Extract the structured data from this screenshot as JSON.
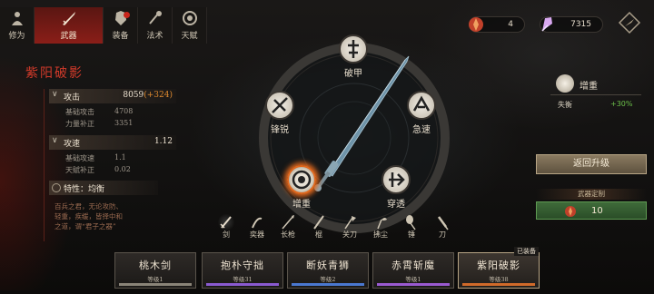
{
  "tabs": [
    {
      "label": "修为",
      "icon": "cultivation-icon"
    },
    {
      "label": "武器",
      "icon": "weapon-icon",
      "active": true
    },
    {
      "label": "装备",
      "icon": "equipment-icon",
      "badge": true
    },
    {
      "label": "法术",
      "icon": "spell-icon"
    },
    {
      "label": "天赋",
      "icon": "talent-icon"
    }
  ],
  "currency": [
    {
      "icon": "fire-gem-icon",
      "value": "4"
    },
    {
      "icon": "crystal-icon",
      "value": "7315"
    }
  ],
  "weapon": {
    "name": "紫阳破影",
    "attack": {
      "label": "攻击",
      "value": "8059",
      "bonus": "(+324)"
    },
    "attack_sub": [
      {
        "label": "基础攻击",
        "value": "4708"
      },
      {
        "label": "力量补正",
        "value": "3351"
      }
    ],
    "speed": {
      "label": "攻速",
      "value": "1.12"
    },
    "speed_sub": [
      {
        "label": "基础攻速",
        "value": "1.1"
      },
      {
        "label": "天赋补正",
        "value": "0.02"
      }
    ],
    "trait": "特性：均衡",
    "description": "百兵之君，无论攻防、轻重，疾缓，皆择中和之道，谓“君子之器”"
  },
  "skills": [
    {
      "label": "破甲",
      "icon": "armor-break-icon"
    },
    {
      "label": "急速",
      "icon": "haste-icon"
    },
    {
      "label": "穿透",
      "icon": "pierce-icon"
    },
    {
      "label": "增重",
      "icon": "weight-icon",
      "selected": true
    },
    {
      "label": "锋锐",
      "icon": "sharp-icon"
    }
  ],
  "selected_buff": {
    "name": "增重",
    "stat": "失衡",
    "value": "+30%"
  },
  "buttons": {
    "return_upgrade": "返回升级",
    "custom_title": "武器定制",
    "custom_value": "10"
  },
  "types": [
    {
      "label": "剑",
      "selected": true
    },
    {
      "label": "奕器"
    },
    {
      "label": "长枪"
    },
    {
      "label": "棍"
    },
    {
      "label": "关刀"
    },
    {
      "label": "拂尘"
    },
    {
      "label": "锤"
    },
    {
      "label": "刀"
    }
  ],
  "slots": [
    {
      "name": "桃木剑",
      "level": "等级1",
      "color": "#8a8478"
    },
    {
      "name": "抱朴守拙",
      "level": "等级31",
      "color": "#8a5ad0"
    },
    {
      "name": "断妖青狮",
      "level": "等级2",
      "color": "#4a78d0"
    },
    {
      "name": "赤霄斩魔",
      "level": "等级1",
      "color": "#9a5ad0"
    },
    {
      "name": "紫阳破影",
      "level": "等级38",
      "color": "#d06a2a",
      "selected": true
    }
  ],
  "equipped_tag": "已装备",
  "colors": {
    "accent_red": "#d23a2a",
    "selected_glow": "#e0681e",
    "positive": "#6cc04a"
  }
}
